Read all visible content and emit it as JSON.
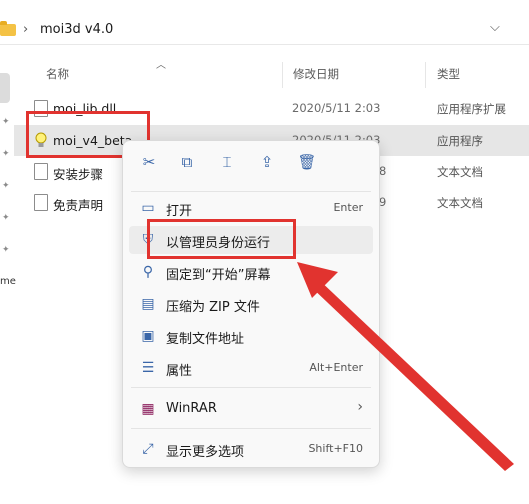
{
  "address": {
    "path": "moi3d v4.0",
    "separator": "›",
    "dropdown": "⌵"
  },
  "headers": {
    "name": "名称",
    "modified": "修改日期",
    "type": "类型"
  },
  "rows": [
    {
      "name": "moi_lib.dll",
      "date": "2020/5/11 2:03",
      "type": "应用程序扩展",
      "icon": "dll-file-icon"
    },
    {
      "name": "moi_v4_beta",
      "date": "2020/5/11 2:03",
      "type": "应用程序",
      "icon": "lightbulb-icon"
    },
    {
      "name": "安装步骤",
      "date": "8",
      "type": "文本文档",
      "icon": "text-file-icon"
    },
    {
      "name": "免责声明",
      "date": "9",
      "type": "文本文档",
      "icon": "text-file-icon"
    }
  ],
  "nav": {
    "partial_text": "me"
  },
  "menu": {
    "quick_actions": [
      "cut-icon",
      "copy-icon",
      "rename-icon",
      "share-icon",
      "delete-icon"
    ],
    "items": [
      {
        "label": "打开",
        "shortcut": "Enter"
      },
      {
        "label": "以管理员身份运行",
        "shortcut": ""
      },
      {
        "label": "固定到“开始”屏幕",
        "shortcut": ""
      },
      {
        "label": "压缩为 ZIP 文件",
        "shortcut": ""
      },
      {
        "label": "复制文件地址",
        "shortcut": ""
      },
      {
        "label": "属性",
        "shortcut": "Alt+Enter"
      },
      {
        "label": "WinRAR",
        "shortcut": "›"
      },
      {
        "label": "显示更多选项",
        "shortcut": "Shift+F10"
      }
    ]
  },
  "colors": {
    "highlight": "#e1332f",
    "selection": "#e6e6e6",
    "accent": "#3a66a8"
  }
}
